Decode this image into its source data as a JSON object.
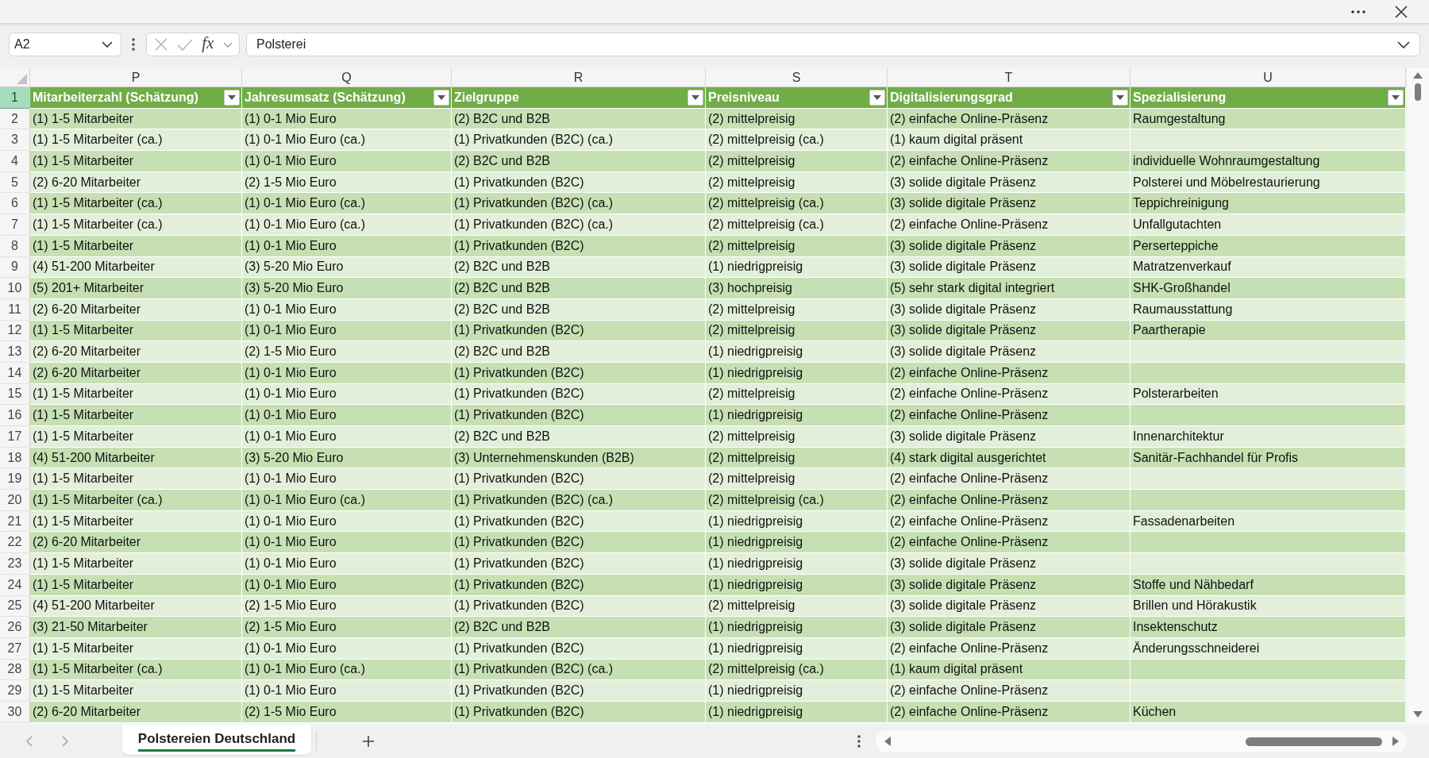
{
  "formula_bar": {
    "name_box": "A2",
    "function_button": "fx",
    "formula": "Polsterei"
  },
  "table": {
    "columns": [
      {
        "letter": "P",
        "heading": "Mitarbeiterzahl (Schätzung)"
      },
      {
        "letter": "Q",
        "heading": "Jahresumsatz (Schätzung)"
      },
      {
        "letter": "R",
        "heading": "Zielgruppe"
      },
      {
        "letter": "S",
        "heading": "Preisniveau"
      },
      {
        "letter": "T",
        "heading": "Digitalisierungsgrad"
      },
      {
        "letter": "U",
        "heading": "Spezialisierung"
      }
    ],
    "header_row": {
      "number": "1",
      "selected": true
    },
    "rows": [
      {
        "number": "2",
        "selected": false,
        "cells": [
          "(1) 1-5 Mitarbeiter",
          "(1) 0-1 Mio Euro",
          "(2) B2C und B2B",
          "(2) mittelpreisig",
          "(2) einfache Online-Präsenz",
          "Raumgestaltung"
        ]
      },
      {
        "number": "3",
        "selected": false,
        "cells": [
          "(1) 1-5 Mitarbeiter (ca.)",
          "(1) 0-1 Mio Euro (ca.)",
          "(1) Privatkunden (B2C) (ca.)",
          "(2) mittelpreisig (ca.)",
          "(1) kaum digital präsent"
        ]
      },
      {
        "number": "4",
        "selected": false,
        "cells": [
          "(1) 1-5 Mitarbeiter",
          "(1) 0-1 Mio Euro",
          "(2) B2C und B2B",
          "(2) mittelpreisig",
          "(2) einfache Online-Präsenz",
          "individuelle Wohnraumgestaltung"
        ]
      },
      {
        "number": "5",
        "selected": false,
        "cells": [
          "(2) 6-20 Mitarbeiter",
          "(2) 1-5 Mio Euro",
          "(1) Privatkunden (B2C)",
          "(2) mittelpreisig",
          "(3) solide digitale Präsenz",
          "Polsterei und Möbelrestaurierung"
        ]
      },
      {
        "number": "6",
        "selected": false,
        "cells": [
          "(1) 1-5 Mitarbeiter (ca.)",
          "(1) 0-1 Mio Euro (ca.)",
          "(1) Privatkunden (B2C) (ca.)",
          "(2) mittelpreisig (ca.)",
          "(3) solide digitale Präsenz",
          "Teppichreinigung"
        ]
      },
      {
        "number": "7",
        "selected": false,
        "cells": [
          "(1) 1-5 Mitarbeiter (ca.)",
          "(1) 0-1 Mio Euro (ca.)",
          "(1) Privatkunden (B2C) (ca.)",
          "(2) mittelpreisig (ca.)",
          "(2) einfache Online-Präsenz",
          "Unfallgutachten"
        ]
      },
      {
        "number": "8",
        "selected": false,
        "cells": [
          "(1) 1-5 Mitarbeiter",
          "(1) 0-1 Mio Euro",
          "(1) Privatkunden (B2C)",
          "(2) mittelpreisig",
          "(3) solide digitale Präsenz",
          "Perserteppiche"
        ]
      },
      {
        "number": "9",
        "selected": false,
        "cells": [
          "(4) 51-200 Mitarbeiter",
          "(3) 5-20 Mio Euro",
          "(2) B2C und B2B",
          "(1) niedrigpreisig",
          "(3) solide digitale Präsenz",
          "Matratzenverkauf"
        ]
      },
      {
        "number": "10",
        "selected": false,
        "cells": [
          "(5) 201+ Mitarbeiter",
          "(3) 5-20 Mio Euro",
          "(2) B2C und B2B",
          "(3) hochpreisig",
          "(5) sehr stark digital integriert",
          "SHK-Großhandel"
        ]
      },
      {
        "number": "11",
        "selected": false,
        "cells": [
          "(2) 6-20 Mitarbeiter",
          "(1) 0-1 Mio Euro",
          "(2) B2C und B2B",
          "(2) mittelpreisig",
          "(3) solide digitale Präsenz",
          "Raumausstattung"
        ]
      },
      {
        "number": "12",
        "selected": false,
        "cells": [
          "(1) 1-5 Mitarbeiter",
          "(1) 0-1 Mio Euro",
          "(1) Privatkunden (B2C)",
          "(2) mittelpreisig",
          "(3) solide digitale Präsenz",
          "Paartherapie"
        ]
      },
      {
        "number": "13",
        "selected": false,
        "cells": [
          "(2) 6-20 Mitarbeiter",
          "(2) 1-5 Mio Euro",
          "(2) B2C und B2B",
          "(1) niedrigpreisig",
          "(3) solide digitale Präsenz"
        ]
      },
      {
        "number": "14",
        "selected": false,
        "cells": [
          "(2) 6-20 Mitarbeiter",
          "(1) 0-1 Mio Euro",
          "(1) Privatkunden (B2C)",
          "(1) niedrigpreisig",
          "(2) einfache Online-Präsenz"
        ]
      },
      {
        "number": "15",
        "selected": false,
        "cells": [
          "(1) 1-5 Mitarbeiter",
          "(1) 0-1 Mio Euro",
          "(1) Privatkunden (B2C)",
          "(2) mittelpreisig",
          "(2) einfache Online-Präsenz",
          "Polsterarbeiten"
        ]
      },
      {
        "number": "16",
        "selected": false,
        "cells": [
          "(1) 1-5 Mitarbeiter",
          "(1) 0-1 Mio Euro",
          "(1) Privatkunden (B2C)",
          "(1) niedrigpreisig",
          "(2) einfache Online-Präsenz"
        ]
      },
      {
        "number": "17",
        "selected": false,
        "cells": [
          "(1) 1-5 Mitarbeiter",
          "(1) 0-1 Mio Euro",
          "(2) B2C und B2B",
          "(2) mittelpreisig",
          "(3) solide digitale Präsenz",
          "Innenarchitektur"
        ]
      },
      {
        "number": "18",
        "selected": false,
        "cells": [
          "(4) 51-200 Mitarbeiter",
          "(3) 5-20 Mio Euro",
          "(3) Unternehmenskunden (B2B)",
          "(2) mittelpreisig",
          "(4) stark digital ausgerichtet",
          "Sanitär-Fachhandel für Profis"
        ]
      },
      {
        "number": "19",
        "selected": false,
        "cells": [
          "(1) 1-5 Mitarbeiter",
          "(1) 0-1 Mio Euro",
          "(1) Privatkunden (B2C)",
          "(2) mittelpreisig",
          "(2) einfache Online-Präsenz"
        ]
      },
      {
        "number": "20",
        "selected": false,
        "cells": [
          "(1) 1-5 Mitarbeiter (ca.)",
          "(1) 0-1 Mio Euro (ca.)",
          "(1) Privatkunden (B2C) (ca.)",
          "(2) mittelpreisig (ca.)",
          "(2) einfache Online-Präsenz"
        ]
      },
      {
        "number": "21",
        "selected": false,
        "cells": [
          "(1) 1-5 Mitarbeiter",
          "(1) 0-1 Mio Euro",
          "(1) Privatkunden (B2C)",
          "(1) niedrigpreisig",
          "(2) einfache Online-Präsenz",
          "Fassadenarbeiten"
        ]
      },
      {
        "number": "22",
        "selected": false,
        "cells": [
          "(2) 6-20 Mitarbeiter",
          "(1) 0-1 Mio Euro",
          "(1) Privatkunden (B2C)",
          "(1) niedrigpreisig",
          "(2) einfache Online-Präsenz"
        ]
      },
      {
        "number": "23",
        "selected": false,
        "cells": [
          "(1) 1-5 Mitarbeiter",
          "(1) 0-1 Mio Euro",
          "(1) Privatkunden (B2C)",
          "(1) niedrigpreisig",
          "(3) solide digitale Präsenz"
        ]
      },
      {
        "number": "24",
        "selected": false,
        "cells": [
          "(1) 1-5 Mitarbeiter",
          "(1) 0-1 Mio Euro",
          "(1) Privatkunden (B2C)",
          "(1) niedrigpreisig",
          "(3) solide digitale Präsenz",
          "Stoffe und Nähbedarf"
        ]
      },
      {
        "number": "25",
        "selected": false,
        "cells": [
          "(4) 51-200 Mitarbeiter",
          "(2) 1-5 Mio Euro",
          "(1) Privatkunden (B2C)",
          "(2) mittelpreisig",
          "(3) solide digitale Präsenz",
          "Brillen und Hörakustik"
        ]
      },
      {
        "number": "26",
        "selected": false,
        "cells": [
          "(3) 21-50 Mitarbeiter",
          "(2) 1-5 Mio Euro",
          "(2) B2C und B2B",
          "(1) niedrigpreisig",
          "(3) solide digitale Präsenz",
          "Insektenschutz"
        ]
      },
      {
        "number": "27",
        "selected": false,
        "cells": [
          "(1) 1-5 Mitarbeiter",
          "(1) 0-1 Mio Euro",
          "(1) Privatkunden (B2C)",
          "(1) niedrigpreisig",
          "(2) einfache Online-Präsenz",
          "Änderungsschneiderei"
        ]
      },
      {
        "number": "28",
        "selected": false,
        "cells": [
          "(1) 1-5 Mitarbeiter (ca.)",
          "(1) 0-1 Mio Euro (ca.)",
          "(1) Privatkunden (B2C) (ca.)",
          "(2) mittelpreisig (ca.)",
          "(1) kaum digital präsent"
        ]
      },
      {
        "number": "29",
        "selected": false,
        "cells": [
          "(1) 1-5 Mitarbeiter",
          "(1) 0-1 Mio Euro",
          "(1) Privatkunden (B2C)",
          "(1) niedrigpreisig",
          "(2) einfache Online-Präsenz"
        ]
      },
      {
        "number": "30",
        "selected": false,
        "cells": [
          "(2) 6-20 Mitarbeiter",
          "(2) 1-5 Mio Euro",
          "(1) Privatkunden (B2C)",
          "(1) niedrigpreisig",
          "(2) einfache Online-Präsenz",
          "Küchen"
        ]
      }
    ]
  },
  "sheet_tabs": [
    {
      "label": "Polstereien Deutschland",
      "selected": true
    }
  ]
}
